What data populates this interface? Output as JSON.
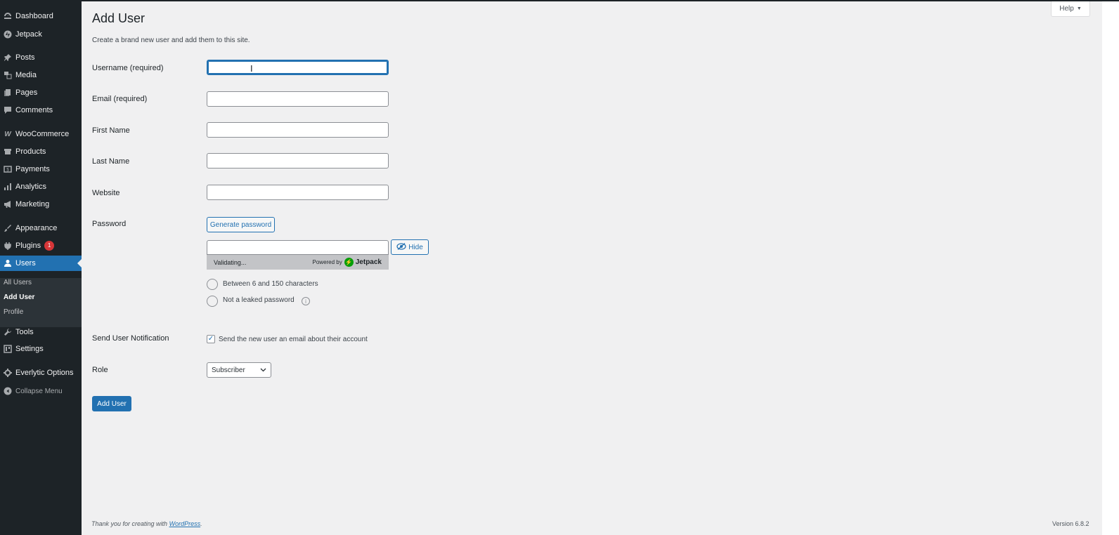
{
  "sidebar": {
    "items": [
      {
        "label": "Dashboard",
        "icon": "dashboard-icon"
      },
      {
        "label": "Jetpack",
        "icon": "jetpack-icon"
      },
      {
        "label": "Posts",
        "icon": "pin-icon"
      },
      {
        "label": "Media",
        "icon": "media-icon"
      },
      {
        "label": "Pages",
        "icon": "pages-icon"
      },
      {
        "label": "Comments",
        "icon": "comment-icon"
      },
      {
        "label": "WooCommerce",
        "icon": "woo-icon"
      },
      {
        "label": "Products",
        "icon": "archive-icon"
      },
      {
        "label": "Payments",
        "icon": "money-icon"
      },
      {
        "label": "Analytics",
        "icon": "bar-chart-icon"
      },
      {
        "label": "Marketing",
        "icon": "megaphone-icon"
      },
      {
        "label": "Appearance",
        "icon": "paintbrush-icon"
      },
      {
        "label": "Plugins",
        "icon": "plug-icon",
        "badge": "1"
      },
      {
        "label": "Users",
        "icon": "user-icon",
        "active": true
      },
      {
        "label": "Tools",
        "icon": "wrench-icon"
      },
      {
        "label": "Settings",
        "icon": "settings-icon"
      },
      {
        "label": "Everlytic Options",
        "icon": "gear-icon"
      },
      {
        "label": "Collapse Menu",
        "icon": "collapse-icon"
      }
    ],
    "submenu": [
      {
        "label": "All Users"
      },
      {
        "label": "Add User",
        "current": true
      },
      {
        "label": "Profile"
      }
    ]
  },
  "help": {
    "label": "Help"
  },
  "page": {
    "title": "Add User",
    "description": "Create a brand new user and add them to this site."
  },
  "form": {
    "username_label": "Username (required)",
    "username_value": "",
    "email_label": "Email (required)",
    "email_value": "",
    "first_name_label": "First Name",
    "first_name_value": "",
    "last_name_label": "Last Name",
    "last_name_value": "",
    "website_label": "Website",
    "website_value": "",
    "password_label": "Password",
    "generate_password_label": "Generate password",
    "password_value": "",
    "hide_label": "Hide",
    "strength_status": "Validating...",
    "powered_by": "Powered by",
    "jetpack_brand": "Jetpack",
    "rule_length": "Between 6 and 150 characters",
    "rule_leaked": "Not a leaked password",
    "notification_label": "Send User Notification",
    "notification_text": "Send the new user an email about their account",
    "notification_checked": true,
    "role_label": "Role",
    "role_value": "Subscriber",
    "submit_label": "Add User"
  },
  "footer": {
    "thanks_prefix": "Thank you for creating with",
    "thanks_link": "WordPress",
    "thanks_suffix": ".",
    "version": "Version 6.8.2"
  },
  "colors": {
    "sidebar_bg": "#1d2327",
    "accent": "#2271b1",
    "badge": "#d63638",
    "jetpack_green": "#069e08",
    "page_bg": "#f0f0f1"
  }
}
